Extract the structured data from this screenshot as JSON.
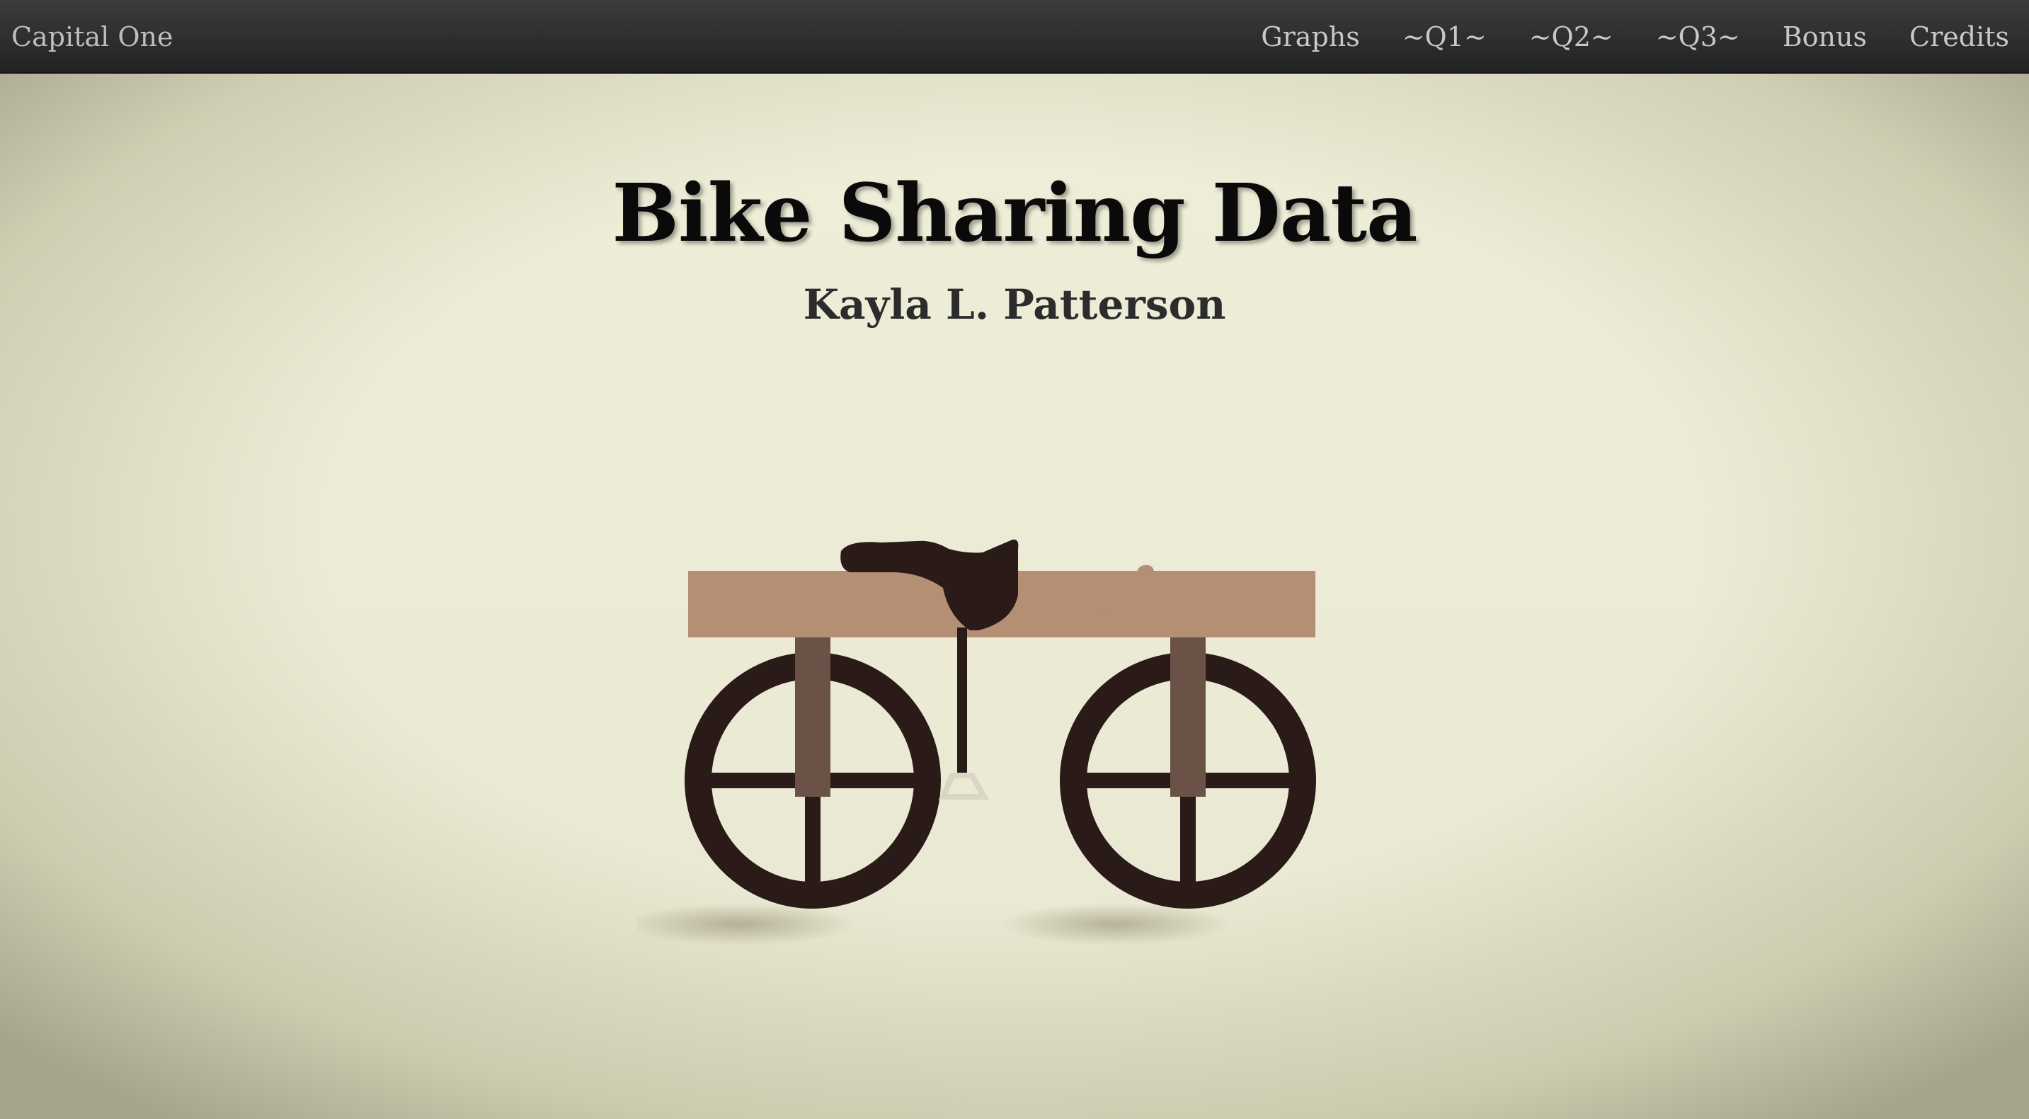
{
  "navbar": {
    "brand": "Capital One",
    "links": [
      "Graphs",
      "~Q1~",
      "~Q2~",
      "~Q3~",
      "Bonus",
      "Credits"
    ]
  },
  "hero": {
    "title": "Bike Sharing Data",
    "author": "Kayla L. Patterson",
    "illustration": "draisine-bicycle-illustration"
  },
  "colors": {
    "navbar": "#2e2e2e",
    "background": "#ebead5",
    "bike_frame": "#b48f74",
    "bike_dark": "#2a1a18",
    "bike_strut": "#6a5246"
  }
}
